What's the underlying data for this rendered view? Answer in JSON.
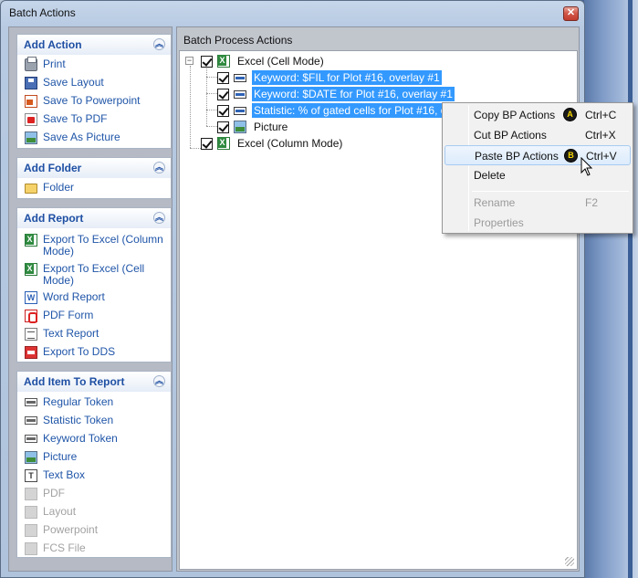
{
  "window": {
    "title": "Batch Actions"
  },
  "colors": {
    "accent_link": "#1f55a8",
    "selection": "#3399ff",
    "badge_text": "#f5d500"
  },
  "sidebar": {
    "sections": [
      {
        "title": "Add Action",
        "items": [
          {
            "label": "Print",
            "icon": "printer-icon"
          },
          {
            "label": "Save Layout",
            "icon": "floppy-disk-icon"
          },
          {
            "label": "Save To Powerpoint",
            "icon": "powerpoint-icon"
          },
          {
            "label": "Save To PDF",
            "icon": "pdf-icon"
          },
          {
            "label": "Save As Picture",
            "icon": "picture-icon"
          }
        ]
      },
      {
        "title": "Add Folder",
        "items": [
          {
            "label": "Folder",
            "icon": "folder-icon"
          }
        ]
      },
      {
        "title": "Add Report",
        "items": [
          {
            "label": "Export To Excel (Column Mode)",
            "icon": "excel-icon"
          },
          {
            "label": "Export To Excel (Cell Mode)",
            "icon": "excel-icon"
          },
          {
            "label": "Word Report",
            "icon": "word-icon"
          },
          {
            "label": "PDF Form",
            "icon": "pdf-form-icon"
          },
          {
            "label": "Text Report",
            "icon": "text-report-icon"
          },
          {
            "label": "Export To DDS",
            "icon": "dds-icon"
          }
        ]
      },
      {
        "title": "Add Item To Report",
        "items": [
          {
            "label": "Regular Token",
            "icon": "token-icon"
          },
          {
            "label": "Statistic Token",
            "icon": "token-icon"
          },
          {
            "label": "Keyword Token",
            "icon": "token-icon"
          },
          {
            "label": "Picture",
            "icon": "picture-icon"
          },
          {
            "label": "Text Box",
            "icon": "text-box-icon"
          },
          {
            "label": "PDF",
            "icon": "pdf-icon",
            "disabled": true
          },
          {
            "label": "Layout",
            "icon": "layout-icon",
            "disabled": true
          },
          {
            "label": "Powerpoint",
            "icon": "powerpoint-icon",
            "disabled": true
          },
          {
            "label": "FCS File",
            "icon": "fcs-file-icon",
            "disabled": true
          }
        ]
      }
    ]
  },
  "main": {
    "header": "Batch Process Actions",
    "tree": {
      "root1": {
        "label": "Excel (Cell Mode)",
        "expander": "−"
      },
      "children": [
        {
          "label": "Keyword: $FIL for Plot #16, overlay #1",
          "selected": true
        },
        {
          "label": "Keyword: $DATE for Plot #16, overlay #1",
          "selected": true
        },
        {
          "label": "Statistic: % of gated cells for Plot #16, overlay #1",
          "selected": true
        },
        {
          "label": "Picture",
          "selected": false
        }
      ],
      "root2": {
        "label": "Excel (Column Mode)"
      }
    }
  },
  "context_menu": {
    "items": [
      {
        "label": "Copy BP Actions",
        "shortcut": "Ctrl+C",
        "badge": "A"
      },
      {
        "label": "Cut BP Actions",
        "shortcut": "Ctrl+X"
      },
      {
        "label": "Paste BP Actions",
        "shortcut": "Ctrl+V",
        "badge": "B"
      },
      {
        "label": "Delete",
        "shortcut": ""
      },
      {
        "label": "Rename",
        "shortcut": "F2",
        "disabled": true
      },
      {
        "label": "Properties",
        "shortcut": "",
        "disabled": true
      }
    ]
  }
}
